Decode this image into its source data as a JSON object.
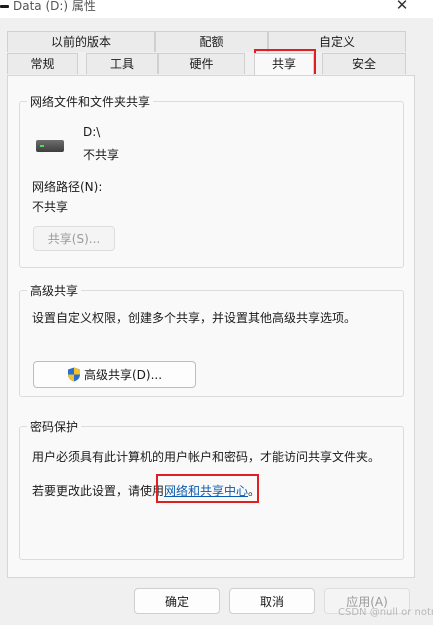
{
  "window": {
    "title": "Data (D:) 属性",
    "close_glyph": "✕"
  },
  "tabs": {
    "row_top": [
      "以前的版本",
      "配额",
      "自定义"
    ],
    "row_bottom": [
      "常规",
      "工具",
      "硬件",
      "共享",
      "安全"
    ],
    "active": "共享"
  },
  "network_sharing": {
    "legend": "网络文件和文件夹共享",
    "drive_name": "D:\\",
    "drive_status": "不共享",
    "path_label": "网络路径(N):",
    "path_value": "不共享",
    "share_button": "共享(S)..."
  },
  "advanced_sharing": {
    "legend": "高级共享",
    "description": "设置自定义权限，创建多个共享，并设置其他高级共享选项。",
    "button": "高级共享(D)..."
  },
  "password_protection": {
    "legend": "密码保护",
    "description": "用户必须具有此计算机的用户帐户和密码，才能访问共享文件夹。",
    "change_prefix": "若要更改此设置，请使用",
    "link": "网络和共享中心",
    "change_suffix": "。"
  },
  "buttons": {
    "ok": "确定",
    "cancel": "取消",
    "apply": "应用(A)"
  },
  "watermark": "CSDN @null or notnull",
  "colors": {
    "highlight_box": "#e02020",
    "link": "#0b5cad"
  }
}
